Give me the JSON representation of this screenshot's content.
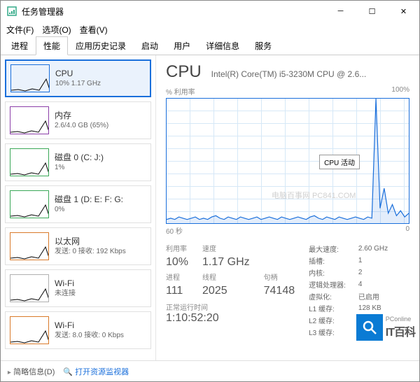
{
  "window": {
    "title": "任务管理器",
    "menus": [
      "文件(F)",
      "选项(O)",
      "查看(V)"
    ]
  },
  "tabs": [
    "进程",
    "性能",
    "应用历史记录",
    "启动",
    "用户",
    "详细信息",
    "服务"
  ],
  "active_tab": "性能",
  "sidebar": [
    {
      "name": "CPU",
      "value": "10% 1.17 GHz",
      "type": "cpu",
      "selected": true
    },
    {
      "name": "内存",
      "value": "2.6/4.0 GB (65%)",
      "type": "mem"
    },
    {
      "name": "磁盘 0 (C: J:)",
      "value": "1%",
      "type": "disk"
    },
    {
      "name": "磁盘 1 (D: E: F: G:",
      "value": "0%",
      "type": "disk"
    },
    {
      "name": "以太网",
      "value": "发送: 0 接收: 192 Kbps",
      "type": "net"
    },
    {
      "name": "Wi-Fi",
      "value": "未连接",
      "type": "wifi"
    },
    {
      "name": "Wi-Fi",
      "value": "发送: 8.0 接收: 0 Kbps",
      "type": "net"
    }
  ],
  "detail": {
    "title": "CPU",
    "subtitle": "Intel(R) Core(TM) i5-3230M CPU @ 2.6...",
    "chart_ylabel": "% 利用率",
    "chart_ymax": "100%",
    "chart_xlabel": "60 秒",
    "chart_xright": "0",
    "tooltip": "CPU 活动",
    "stats_primary": [
      {
        "label": "利用率",
        "value": "10%"
      },
      {
        "label": "速度",
        "value": "1.17 GHz"
      },
      {
        "label": "进程",
        "value": "111"
      },
      {
        "label": "线程",
        "value": "2025"
      },
      {
        "label": "句柄",
        "value": "74148"
      }
    ],
    "uptime_label": "正常运行时间",
    "uptime_value": "1:10:52:20",
    "specs": [
      {
        "k": "最大速度:",
        "v": "2.60 GHz"
      },
      {
        "k": "插槽:",
        "v": "1"
      },
      {
        "k": "内核:",
        "v": "2"
      },
      {
        "k": "逻辑处理器:",
        "v": "4"
      },
      {
        "k": "虚拟化:",
        "v": "已启用"
      },
      {
        "k": "L1 缓存:",
        "v": "128 KB"
      },
      {
        "k": "L2 缓存:",
        "v": "512 KB"
      },
      {
        "k": "L3 缓存:",
        "v": "3.0 MB"
      }
    ]
  },
  "statusbar": {
    "fewer": "简略信息(D)",
    "resmon": "打开资源监视器"
  },
  "watermark": {
    "brand": "PConline",
    "main": "IT百科",
    "center": "电脑百事网 PC841.COM"
  },
  "chart_data": {
    "type": "line",
    "title": "CPU 活动",
    "xlabel": "60 秒",
    "ylabel": "% 利用率",
    "ylim": [
      0,
      100
    ],
    "xlim_seconds": [
      60,
      0
    ],
    "series": [
      {
        "name": "CPU",
        "values_pct": [
          3,
          4,
          3,
          5,
          4,
          3,
          4,
          5,
          3,
          4,
          3,
          5,
          6,
          4,
          3,
          5,
          4,
          3,
          5,
          4,
          3,
          4,
          5,
          3,
          4,
          5,
          4,
          3,
          5,
          4,
          3,
          4,
          5,
          4,
          3,
          5,
          6,
          4,
          3,
          5,
          4,
          3,
          5,
          4,
          3,
          4,
          5,
          4,
          3,
          5,
          4,
          100,
          12,
          28,
          8,
          15,
          6,
          10,
          5,
          8
        ]
      }
    ]
  }
}
